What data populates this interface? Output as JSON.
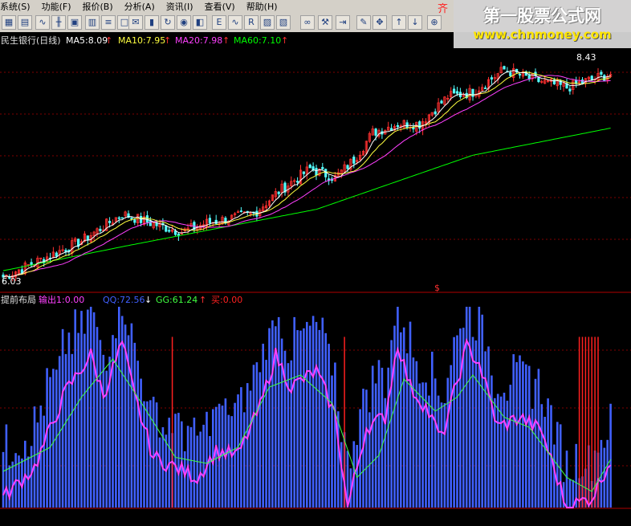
{
  "menu": {
    "items": [
      "系统(S)",
      "功能(F)",
      "报价(B)",
      "分析(A)",
      "资讯(I)",
      "查看(V)",
      "帮助(H)"
    ]
  },
  "watermark": {
    "line1": "第一股票公式网",
    "line2": "www.chnmoney.com",
    "corner": "齐"
  },
  "colors": {
    "background": "#000000",
    "candle_up": "#ff3030",
    "candle_down": "#54ffff",
    "ma5": "#ffffff",
    "ma10": "#ffff40",
    "ma20": "#ff40ff",
    "ma60": "#00ff00",
    "bars": "#4060ff",
    "qq": "#ff40ff",
    "gg": "#40ff40",
    "signal": "#ff2020",
    "panel_separator": "#b00000"
  },
  "chart_data": [
    {
      "type": "candlestick",
      "title": "民生银行(日线)",
      "indicators": [
        {
          "name": "MA5",
          "value": "8.09",
          "color": "#ffffff"
        },
        {
          "name": "MA10",
          "value": "7.95",
          "color": "#ffff40"
        },
        {
          "name": "MA20",
          "value": "7.98",
          "color": "#ff40ff"
        },
        {
          "name": "MA60",
          "value": "7.10",
          "color": "#00ff00"
        }
      ],
      "ylim": [
        6.05,
        8.55
      ],
      "high_label": "8.43",
      "low_label": "6.03",
      "n": 195,
      "anchors": {
        "close": [
          [
            0,
            6.05
          ],
          [
            25,
            6.45
          ],
          [
            38,
            6.75
          ],
          [
            47,
            6.65
          ],
          [
            57,
            6.55
          ],
          [
            65,
            6.65
          ],
          [
            80,
            6.75
          ],
          [
            88,
            7.0
          ],
          [
            98,
            7.25
          ],
          [
            106,
            7.15
          ],
          [
            112,
            7.35
          ],
          [
            118,
            7.65
          ],
          [
            126,
            7.75
          ],
          [
            133,
            7.75
          ],
          [
            142,
            8.05
          ],
          [
            150,
            8.1
          ],
          [
            156,
            8.25
          ],
          [
            160,
            8.35
          ],
          [
            168,
            8.25
          ],
          [
            180,
            8.15
          ],
          [
            186,
            8.22
          ],
          [
            194,
            8.3
          ]
        ],
        "ma60": [
          [
            0,
            6.12
          ],
          [
            40,
            6.4
          ],
          [
            100,
            6.8
          ],
          [
            150,
            7.4
          ],
          [
            194,
            7.7
          ]
        ]
      },
      "ma60_cross_marker": "$"
    },
    {
      "type": "bar+line",
      "title": "提前布局",
      "indicators": [
        {
          "name": "输出",
          "value": "1:0.00",
          "color": "#ff40ff"
        },
        {
          "name": "QQ",
          "value": "72.56",
          "color": "#4060ff"
        },
        {
          "name": "GG",
          "value": "61.24",
          "color": "#40ff40"
        },
        {
          "name": "买",
          "value": "0.00",
          "color": "#ff2020"
        }
      ],
      "ylim": [
        0,
        100
      ],
      "n": 195,
      "anchors": {
        "qq": [
          [
            0,
            5
          ],
          [
            10,
            20
          ],
          [
            20,
            58
          ],
          [
            28,
            76
          ],
          [
            32,
            56
          ],
          [
            38,
            82
          ],
          [
            42,
            55
          ],
          [
            48,
            25
          ],
          [
            55,
            20
          ],
          [
            62,
            15
          ],
          [
            68,
            28
          ],
          [
            75,
            26
          ],
          [
            82,
            50
          ],
          [
            87,
            76
          ],
          [
            92,
            60
          ],
          [
            100,
            68
          ],
          [
            106,
            46
          ],
          [
            110,
            0
          ],
          [
            116,
            40
          ],
          [
            122,
            45
          ],
          [
            126,
            82
          ],
          [
            130,
            60
          ],
          [
            135,
            50
          ],
          [
            140,
            34
          ],
          [
            148,
            80
          ],
          [
            152,
            72
          ],
          [
            158,
            40
          ],
          [
            165,
            45
          ],
          [
            172,
            38
          ],
          [
            180,
            0
          ],
          [
            188,
            5
          ],
          [
            194,
            24
          ]
        ],
        "gg": [
          [
            0,
            18
          ],
          [
            15,
            30
          ],
          [
            25,
            55
          ],
          [
            35,
            74
          ],
          [
            45,
            50
          ],
          [
            55,
            25
          ],
          [
            65,
            22
          ],
          [
            75,
            30
          ],
          [
            85,
            60
          ],
          [
            95,
            66
          ],
          [
            105,
            52
          ],
          [
            113,
            15
          ],
          [
            120,
            26
          ],
          [
            128,
            64
          ],
          [
            138,
            48
          ],
          [
            145,
            55
          ],
          [
            150,
            66
          ],
          [
            160,
            45
          ],
          [
            168,
            40
          ],
          [
            180,
            15
          ],
          [
            188,
            8
          ],
          [
            194,
            24
          ]
        ]
      },
      "signal_spikes": [
        54,
        109,
        184,
        185,
        186,
        187,
        188,
        189,
        190
      ]
    }
  ]
}
